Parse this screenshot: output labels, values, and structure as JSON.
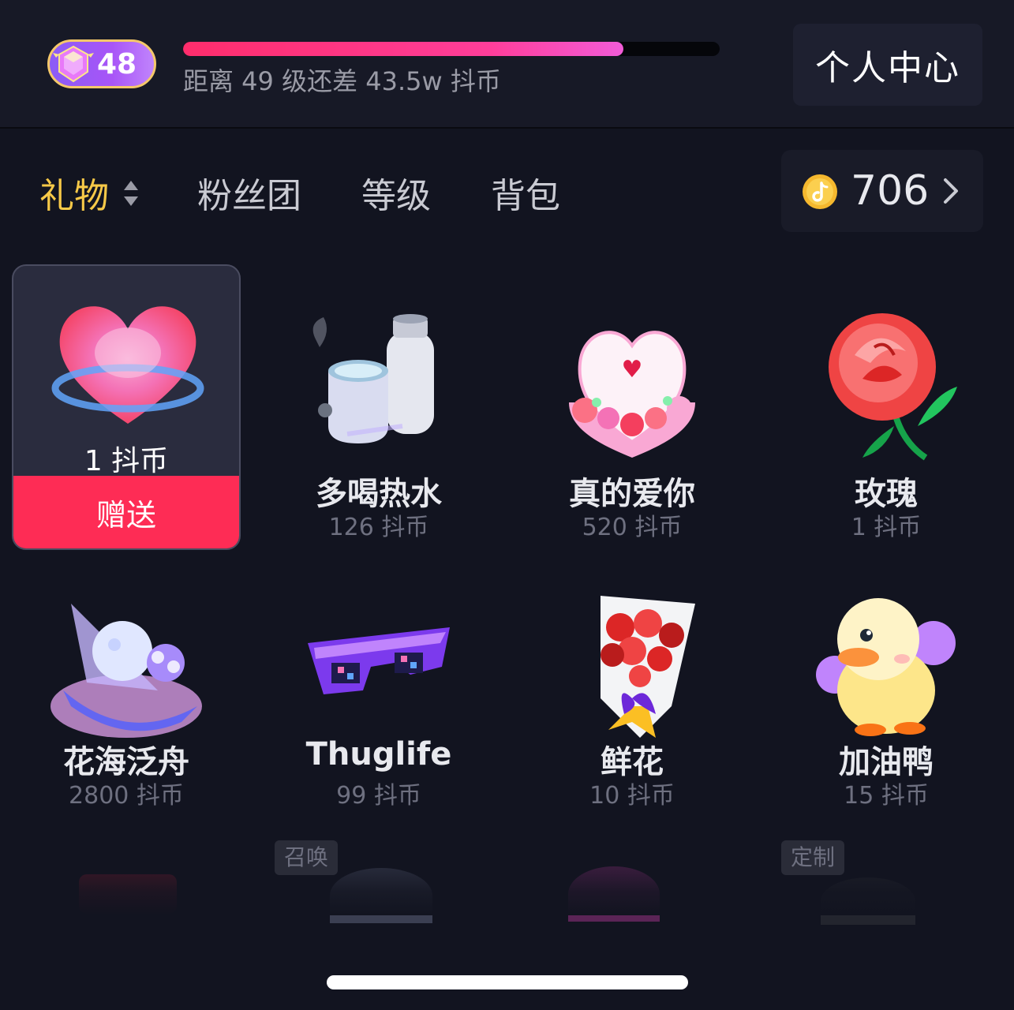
{
  "top_bar": {
    "level": "48",
    "progress_percent": 82,
    "progress_text": "距离 49 级还差 43.5w 抖币",
    "profile_button": "个人中心"
  },
  "tabs": {
    "items": [
      {
        "label": "礼物",
        "active": true
      },
      {
        "label": "粉丝团",
        "active": false
      },
      {
        "label": "等级",
        "active": false
      },
      {
        "label": "背包",
        "active": false
      }
    ],
    "coin_balance": "706"
  },
  "gifts": [
    {
      "name": "",
      "price": "1 抖币",
      "selected": true,
      "send_label": "赠送"
    },
    {
      "name": "多喝热水",
      "price": "126 抖币"
    },
    {
      "name": "真的爱你",
      "price": "520 抖币"
    },
    {
      "name": "玫瑰",
      "price": "1 抖币"
    },
    {
      "name": "花海泛舟",
      "price": "2800 抖币"
    },
    {
      "name": "Thuglife",
      "price": "99 抖币"
    },
    {
      "name": "鲜花",
      "price": "10 抖币"
    },
    {
      "name": "加油鸭",
      "price": "15 抖币"
    }
  ],
  "partial_row_tags": [
    "召唤",
    "定制"
  ],
  "colors": {
    "accent_pink": "#fe2c55",
    "active_tab": "#f7c948",
    "background": "#121420"
  },
  "icons": {
    "level_badge": "level-gem-icon",
    "sort": "sort-arrows-icon",
    "coin": "douyin-coin-icon",
    "chevron": "chevron-right-icon"
  }
}
